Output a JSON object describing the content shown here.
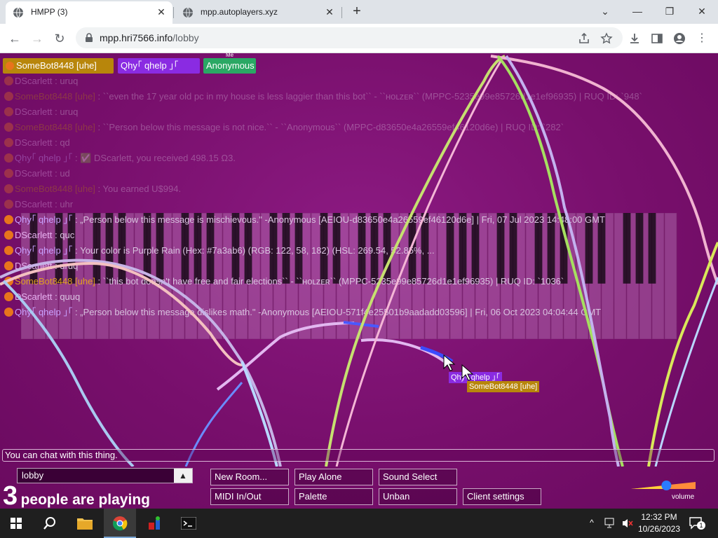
{
  "browser": {
    "tabs": [
      {
        "title": "HMPP (3)",
        "active": true
      },
      {
        "title": "mpp.autoplayers.xyz",
        "active": false
      }
    ],
    "new_tab": "+",
    "window_controls": {
      "tab_search": "⌄",
      "minimize": "—",
      "restore": "❐",
      "close": "✕"
    },
    "address": {
      "host": "mpp.hri7566.info",
      "path": "/lobby"
    }
  },
  "userbar": [
    {
      "name": "SomeBot8448 [uhe]",
      "color": "#b8860b",
      "me": false
    },
    {
      "name": "Qhy｢ qhelp ｣｢ ",
      "color": "#8a2be2",
      "me": false
    },
    {
      "name": "Anonymous",
      "color": "#2aa864",
      "me": true,
      "me_label": "Me"
    }
  ],
  "chat": [
    {
      "user": "DScarlett",
      "msg": ": uruq",
      "color": "#e7b1f0",
      "faint": true
    },
    {
      "user": "SomeBot8448 [uhe]",
      "msg": ": ``even the 17 year old pc in my house is less laggier than this bot`` - ``ʜᴏʟᴢᴇʀ`` (MPPC-5235e99e85726d1e1ef96935) | RUQ ID: `948`",
      "color": "#b8860b",
      "faint": true
    },
    {
      "user": "DScarlett",
      "msg": ": uruq",
      "color": "#e7b1f0",
      "faint": true
    },
    {
      "user": "SomeBot8448 [uhe]",
      "msg": ": ``Person below this message is not nice.`` - ``Anonymous`` (MPPC-d83650e4a26559ef46120d6e) | RUQ ID: `282`",
      "color": "#b8860b",
      "faint": true
    },
    {
      "user": "DScarlett",
      "msg": ": qd",
      "color": "#e7b1f0",
      "faint": true
    },
    {
      "user": "Qhy｢ qhelp ｣｢",
      "msg": ": ✅ DScarlett, you received 498.15 Ω3.",
      "color": "#c9a1ff",
      "faint": true
    },
    {
      "user": "DScarlett",
      "msg": ": ud",
      "color": "#e7b1f0",
      "faint": true
    },
    {
      "user": "SomeBot8448 [uhe]",
      "msg": ": You earned U$994.",
      "color": "#b8860b",
      "faint": true
    },
    {
      "user": "DScarlett",
      "msg": ": uhr",
      "color": "#e7b1f0",
      "faint": true
    },
    {
      "user": "Qhy｢ qhelp ｣｢",
      "msg": ": „Person below this message is mischievous.\" -Anonymous [AEIOU-d83650e4a26559ef46120d6e] | Fri, 07 Jul 2023 14:48:00 GMT",
      "color": "#c9a1ff",
      "faint": false
    },
    {
      "user": "DScarlett",
      "msg": ": quc",
      "color": "#e7b1f0",
      "faint": false
    },
    {
      "user": "Qhy｢ qhelp ｣｢",
      "msg": ": Your color is Purple Rain (Hex: #7a3ab6) (RGB: 122, 58, 182) (HSL: 269.54, 52.85%, ...",
      "color": "#c9a1ff",
      "faint": false
    },
    {
      "user": "DScarlett",
      "msg": ": uruq",
      "color": "#e7b1f0",
      "faint": false
    },
    {
      "user": "SomeBot8448 [uhe]",
      "msg": ": ``this bot doesn't have free and fair elections`` - ``ʜᴏʟᴢᴇʀ`` (MPPC-5235e99e85726d1e1ef96935) | RUQ ID: `1036`",
      "color": "#e0a020",
      "faint": false
    },
    {
      "user": "DScarlett",
      "msg": ": quuq",
      "color": "#e7b1f0",
      "faint": false
    },
    {
      "user": "Qhy｢ qhelp ｣｢",
      "msg": ": „Person below this message dislikes math.\" -Anonymous [AEIOU-571f4e25501b9aadadd03596] | Fri, 06 Oct 2023 04:04:44 GMT",
      "color": "#c9a1ff",
      "faint": false
    }
  ],
  "cursor_tags": [
    {
      "name": "Qhy｢ qhelp ｣｢ ",
      "color": "#8a2be2"
    },
    {
      "name": "SomeBot8448 [uhe]",
      "color": "#b8860b"
    }
  ],
  "chat_input": {
    "placeholder": "You can chat with this thing."
  },
  "room": {
    "name": "lobby",
    "arrow": "▲"
  },
  "people": {
    "count": "3",
    "text": "people are playing"
  },
  "buttons": {
    "new_room": "New Room...",
    "play_alone": "Play Alone",
    "sound_select": "Sound Select",
    "midi": "MIDI In/Out",
    "palette": "Palette",
    "unban": "Unban",
    "client_settings": "Client settings"
  },
  "volume": {
    "label": "volume",
    "level": 0.55
  },
  "taskbar": {
    "time": "12:32 PM",
    "date": "10/26/2023",
    "notification_count": "1"
  }
}
